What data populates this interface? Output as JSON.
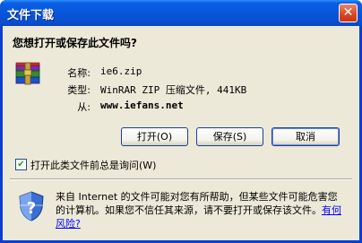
{
  "window": {
    "title": "文件下载",
    "close_glyph": "✕"
  },
  "dialog": {
    "heading": "您想打开或保存此文件吗?",
    "fields": [
      {
        "label": "名称:",
        "value": "ie6.zip"
      },
      {
        "label": "类型:",
        "value": "WinRAR ZIP 压缩文件, 441KB"
      },
      {
        "label": "从:",
        "value": "www.iefans.net"
      }
    ],
    "buttons": {
      "open": "打开(O)",
      "save": "保存(S)",
      "cancel": "取消"
    },
    "checkbox": {
      "label": "打开此类文件前总是询问(W)",
      "checked": true,
      "check_glyph": "✔"
    },
    "warning": {
      "text": "来自 Internet 的文件可能对您有所帮助，但某些文件可能危害您的计算机。如果您不信任其来源，请不要打开或保存该文件。",
      "link": "有何风险?"
    }
  },
  "colors": {
    "titlebar": "#0756d8",
    "client": "#ece9d8",
    "link": "#0000ff"
  }
}
